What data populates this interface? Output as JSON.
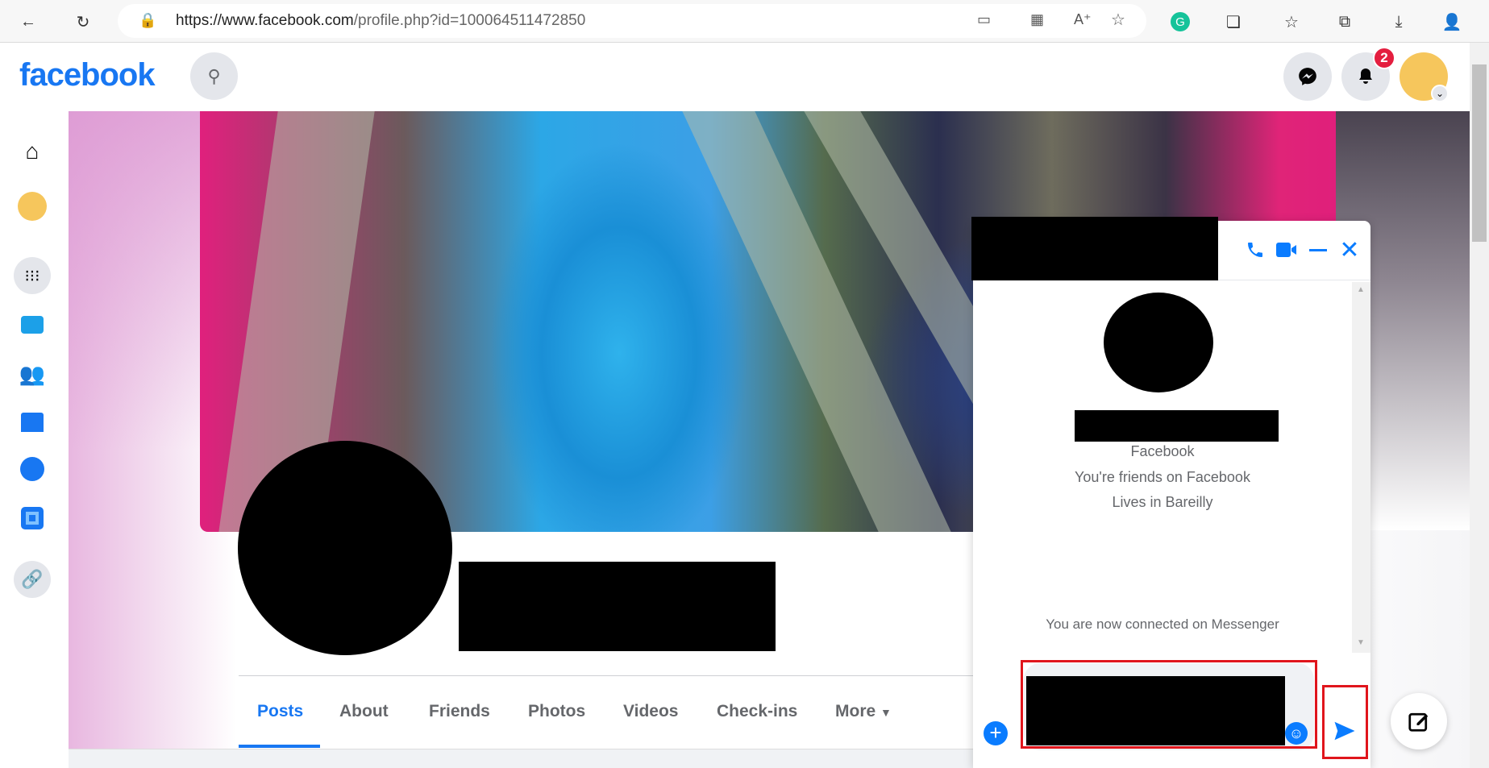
{
  "browser": {
    "url_host": "https://www.facebook.com",
    "url_path": "/profile.php?id=100064511472850",
    "icons": [
      "back-icon",
      "refresh-icon",
      "lock-icon",
      "cast-icon",
      "apps-icon",
      "read-aloud-icon",
      "add-favorite-icon",
      "grammarly-icon",
      "extensions-icon",
      "favorites-icon",
      "collections-icon",
      "downloads-icon",
      "profile-icon"
    ]
  },
  "header": {
    "logo": "facebook",
    "notification_count": "2"
  },
  "profile": {
    "tabs": [
      "Posts",
      "About",
      "Friends",
      "Photos",
      "Videos",
      "Check-ins",
      "More"
    ],
    "active_tab": "Posts"
  },
  "chat": {
    "source": "Facebook",
    "friends_text": "You're friends on Facebook",
    "lives_text": "Lives in Bareilly",
    "connected_text": "You are now connected on Messenger"
  },
  "colors": {
    "brand": "#1877f2",
    "highlight_box": "#e0151c",
    "badge": "#e41e3f"
  }
}
